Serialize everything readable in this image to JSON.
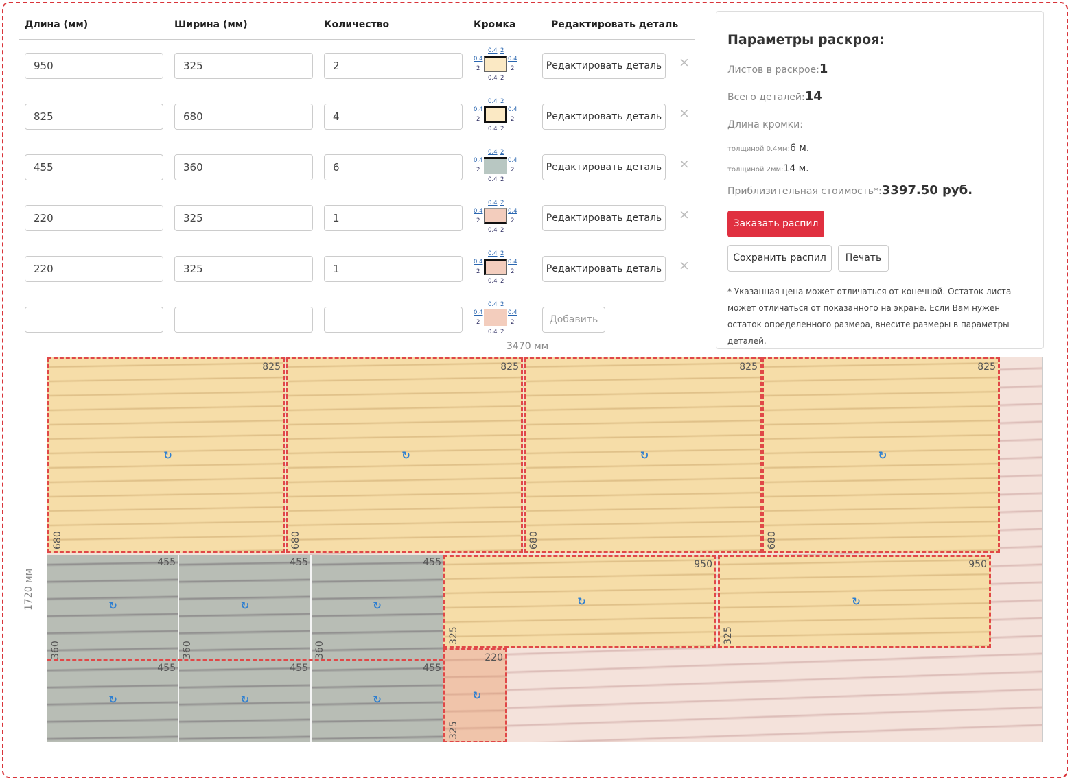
{
  "table": {
    "headers": [
      "Длина (мм)",
      "Ширина (мм)",
      "Количество",
      "Кромка",
      "Редактировать деталь"
    ],
    "rows": [
      {
        "length": "950",
        "width": "325",
        "qty": "2",
        "edit_label": "Редактировать деталь",
        "swatch": "#fbe9c4"
      },
      {
        "length": "825",
        "width": "680",
        "qty": "4",
        "edit_label": "Редактировать деталь",
        "swatch": "#fbe9c4"
      },
      {
        "length": "455",
        "width": "360",
        "qty": "6",
        "edit_label": "Редактировать деталь",
        "swatch": "#b8c7c2"
      },
      {
        "length": "220",
        "width": "325",
        "qty": "1",
        "edit_label": "Редактировать деталь",
        "swatch": "#f3cdbd"
      },
      {
        "length": "220",
        "width": "325",
        "qty": "1",
        "edit_label": "Редактировать деталь",
        "swatch": "#f3cdbd"
      }
    ],
    "new_row": {
      "length": "",
      "width": "",
      "qty": "",
      "add_label": "Добавить"
    },
    "edge_top": "0.4",
    "edge_top2": "2",
    "edge_side_a": "0.4",
    "edge_side_b": "2",
    "delete_glyph": "×"
  },
  "params": {
    "title": "Параметры раскроя:",
    "sheets_label": "Листов в раскрое:",
    "sheets_value": "1",
    "parts_label": "Всего деталей:",
    "parts_value": "14",
    "edge_len_label": "Длина кромки:",
    "edge04_label": "толщиной 0.4мм:",
    "edge04_value": "6 м.",
    "edge2_label": "толщиной 2мм:",
    "edge2_value": "14 м.",
    "cost_label": "Приблизительная стоимость*:",
    "cost_value": "3397.50 руб.",
    "order_label": "Заказать распил",
    "save_label": "Сохранить распил",
    "print_label": "Печать",
    "note": "* Указанная цена может отличаться от конечной. Остаток листа может отличаться от показанного на экране. Если Вам нужен остаток определенного размера, внесите размеры в параметры деталей."
  },
  "board": {
    "width_label": "3470 мм",
    "height_label": "1720 мм",
    "pieces": [
      {
        "w": "825",
        "h": "680"
      },
      {
        "w": "825",
        "h": "680"
      },
      {
        "w": "825",
        "h": "680"
      },
      {
        "w": "825",
        "h": "680"
      },
      {
        "w": "455",
        "h": "360"
      },
      {
        "w": "455",
        "h": "360"
      },
      {
        "w": "455",
        "h": "360"
      },
      {
        "w": "950",
        "h": "325"
      },
      {
        "w": "950",
        "h": "325"
      },
      {
        "w": "455",
        "h": ""
      },
      {
        "w": "455",
        "h": ""
      },
      {
        "w": "455",
        "h": ""
      },
      {
        "w": "220",
        "h": "325"
      }
    ],
    "rotate_icon": "↻"
  }
}
